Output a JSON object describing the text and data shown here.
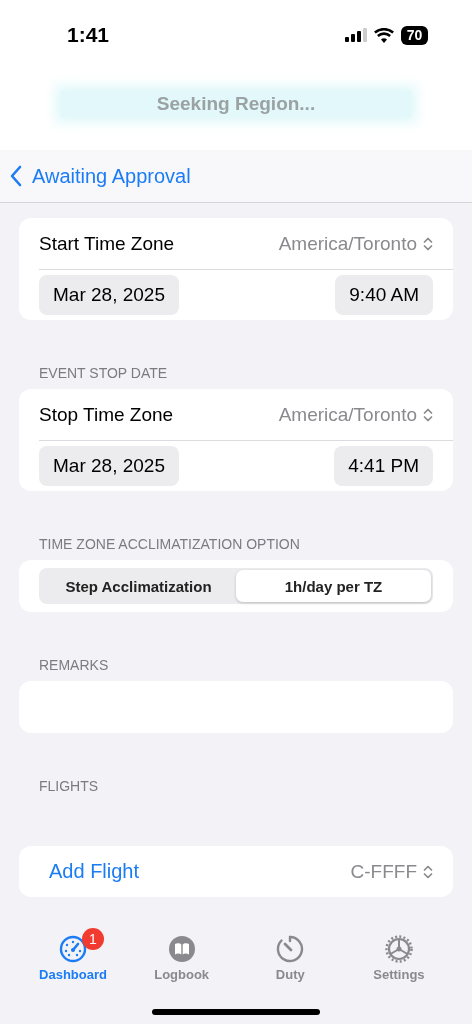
{
  "status_bar": {
    "time": "1:41",
    "battery": "70"
  },
  "banner": {
    "text": "Seeking Region..."
  },
  "nav": {
    "back": "Awaiting Approval"
  },
  "sections": [
    {
      "kind": "datetime",
      "label": "Start Time Zone",
      "zone": "America/Toronto",
      "date": "Mar 28, 2025",
      "time": "9:40 AM"
    },
    {
      "kind": "datetime",
      "header": "EVENT STOP DATE",
      "label": "Stop Time Zone",
      "zone": "America/Toronto",
      "date": "Mar 28, 2025",
      "time": "4:41 PM"
    },
    {
      "kind": "segmented",
      "header": "TIME ZONE ACCLIMATIZATION OPTION",
      "options": [
        {
          "label": "Step Acclimatization",
          "selected": false
        },
        {
          "label": "1h/day per TZ",
          "selected": true
        }
      ]
    },
    {
      "kind": "textarea",
      "header": "REMARKS"
    },
    {
      "kind": "header",
      "header": "FLIGHTS"
    },
    {
      "kind": "addrow",
      "action": "Add Flight",
      "aircraft": "C-FFFF"
    }
  ],
  "tabs": [
    {
      "kind": "dashboard",
      "label": "Dashboard",
      "selected": true,
      "badge": "1"
    },
    {
      "kind": "logbook",
      "label": "Logbook",
      "selected": false
    },
    {
      "kind": "duty",
      "label": "Duty",
      "selected": false
    },
    {
      "kind": "settings",
      "label": "Settings",
      "selected": false
    }
  ]
}
